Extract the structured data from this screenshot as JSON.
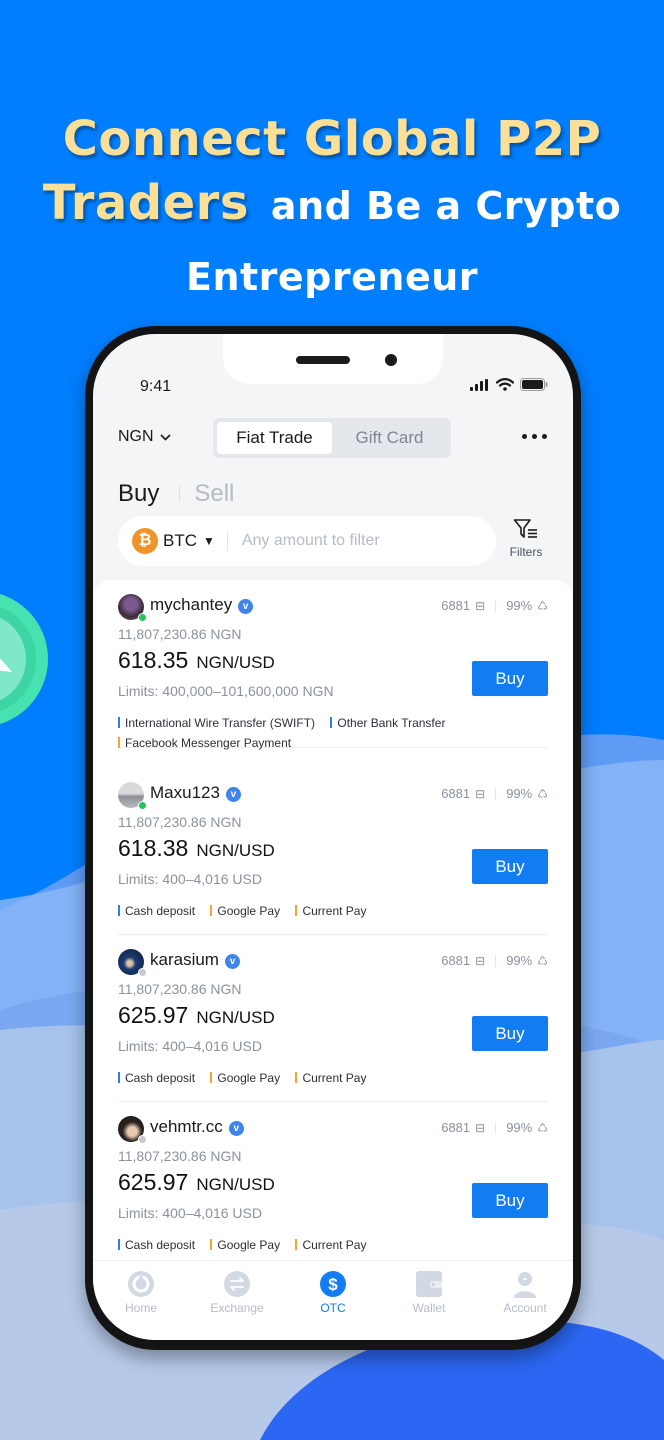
{
  "colors": {
    "background": "#007efe",
    "headline_accent": "#f9df97",
    "primary": "#127cf3",
    "online": "#22c55e",
    "offline": "#c5cad2",
    "method_blue": "#2f7ef0",
    "method_orange": "#f2a533"
  },
  "headline": {
    "line1": "Connect Global P2P",
    "line2_highlight": "Traders",
    "line2_rest": "and Be a Crypto",
    "line3": "Entrepreneur"
  },
  "status_bar": {
    "time": "9:41",
    "icons": [
      "signal-icon",
      "wifi-icon",
      "battery-icon"
    ]
  },
  "topbar": {
    "currency": "NGN",
    "tabs": [
      {
        "label": "Fiat Trade",
        "active": true
      },
      {
        "label": "Gift Card",
        "active": false
      }
    ],
    "more_icon": "more-horizontal-icon"
  },
  "trade_tabs": {
    "buy": "Buy",
    "sell": "Sell",
    "active": "buy"
  },
  "search": {
    "coin": "BTC",
    "coin_icon": "bitcoin-icon",
    "amount_value": "",
    "amount_placeholder": "Any amount to filter",
    "filters_label": "Filters"
  },
  "offers": [
    {
      "name": "mychantey",
      "online": true,
      "verified": true,
      "orders": "6881",
      "completion": "99%",
      "available": "11,807,230.86 NGN",
      "price": "618.35",
      "unit": "NGN/USD",
      "limits": "Limits:  400,000–101,600,000 NGN",
      "methods": [
        {
          "label": "International Wire Transfer (SWIFT)",
          "color": "blue"
        },
        {
          "label": "Other Bank Transfer",
          "color": "blue"
        },
        {
          "label": "Facebook Messenger Payment",
          "color": "orange"
        }
      ],
      "button": "Buy"
    },
    {
      "name": "Maxu123",
      "online": true,
      "verified": true,
      "orders": "6881",
      "completion": "99%",
      "available": "11,807,230.86 NGN",
      "price": "618.38",
      "unit": "NGN/USD",
      "limits": "Limits: 400–4,016 USD",
      "methods": [
        {
          "label": "Cash deposit",
          "color": "blue"
        },
        {
          "label": "Google Pay",
          "color": "orange"
        },
        {
          "label": "Current Pay",
          "color": "orange"
        }
      ],
      "button": "Buy"
    },
    {
      "name": "karasium",
      "online": false,
      "verified": true,
      "orders": "6881",
      "completion": "99%",
      "available": "11,807,230.86 NGN",
      "price": "625.97",
      "unit": "NGN/USD",
      "limits": "Limits: 400–4,016 USD",
      "methods": [
        {
          "label": "Cash deposit",
          "color": "blue"
        },
        {
          "label": "Google Pay",
          "color": "orange"
        },
        {
          "label": "Current Pay",
          "color": "orange"
        }
      ],
      "button": "Buy"
    },
    {
      "name": "vehmtr.cc",
      "online": false,
      "verified": true,
      "orders": "6881",
      "completion": "99%",
      "available": "11,807,230.86 NGN",
      "price": "625.97",
      "unit": "NGN/USD",
      "limits": "Limits: 400–4,016 USD",
      "methods": [
        {
          "label": "Cash deposit",
          "color": "blue"
        },
        {
          "label": "Google Pay",
          "color": "orange"
        },
        {
          "label": "Current Pay",
          "color": "orange"
        }
      ],
      "button": "Buy"
    }
  ],
  "bottom_nav": [
    {
      "label": "Home",
      "icon": "home-icon",
      "active": false
    },
    {
      "label": "Exchange",
      "icon": "exchange-icon",
      "active": false
    },
    {
      "label": "OTC",
      "icon": "dollar-icon",
      "active": true
    },
    {
      "label": "Wallet",
      "icon": "wallet-icon",
      "active": false
    },
    {
      "label": "Account",
      "icon": "account-icon",
      "active": false
    }
  ]
}
